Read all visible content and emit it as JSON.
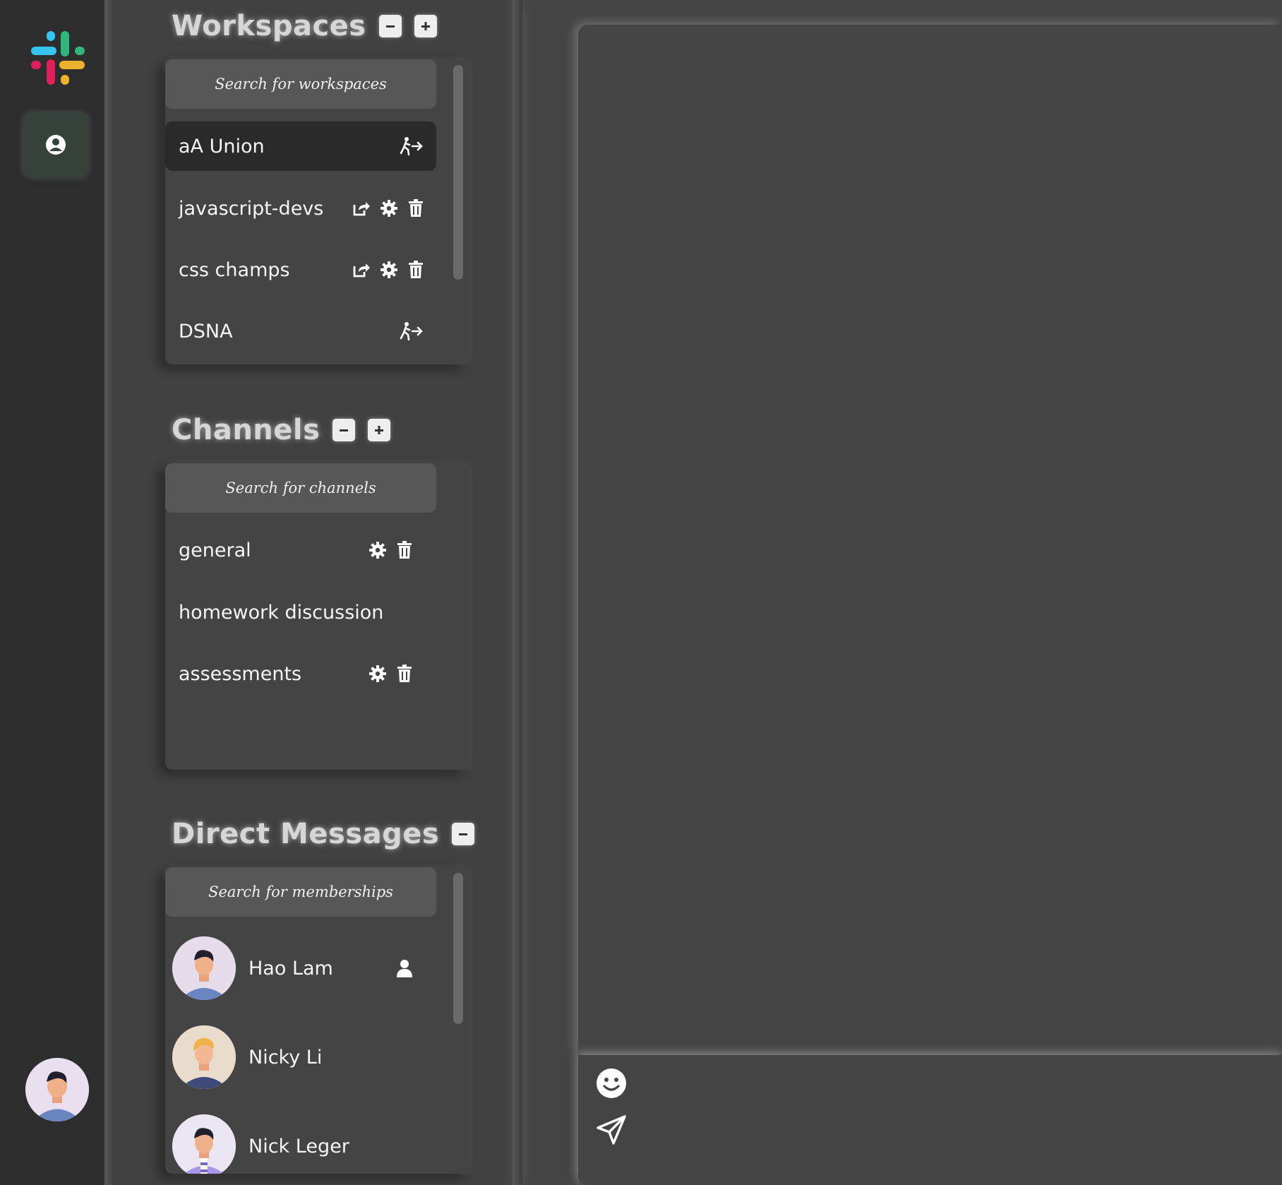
{
  "workspaces": {
    "title": "Workspaces",
    "search_placeholder": "Search for workspaces",
    "items": [
      {
        "label": "aA Union"
      },
      {
        "label": "javascript-devs"
      },
      {
        "label": "css champs"
      },
      {
        "label": "DSNA"
      }
    ]
  },
  "channels": {
    "title": "Channels",
    "search_placeholder": "Search for channels",
    "items": [
      {
        "label": "general"
      },
      {
        "label": "homework discussion"
      },
      {
        "label": "assessments"
      }
    ]
  },
  "direct_messages": {
    "title": "Direct Messages",
    "search_placeholder": "Search for memberships",
    "items": [
      {
        "label": "Hao Lam"
      },
      {
        "label": "Nicky Li"
      },
      {
        "label": "Nick Leger"
      }
    ]
  },
  "icons": {
    "logo": "slack-logo-icon",
    "profile": "user-circle-icon",
    "leave": "leave-walk-icon",
    "share": "share-icon",
    "settings": "gear-icon",
    "delete": "trash-icon",
    "collapse": "minus-square-icon",
    "add": "plus-square-icon",
    "member": "user-icon",
    "emoji": "smile-icon",
    "send": "paper-plane-icon"
  },
  "colors": {
    "background": "#444444",
    "rail": "#2d2d2d",
    "active_row": "#2a2a2a",
    "profile_button": "#36413a"
  }
}
